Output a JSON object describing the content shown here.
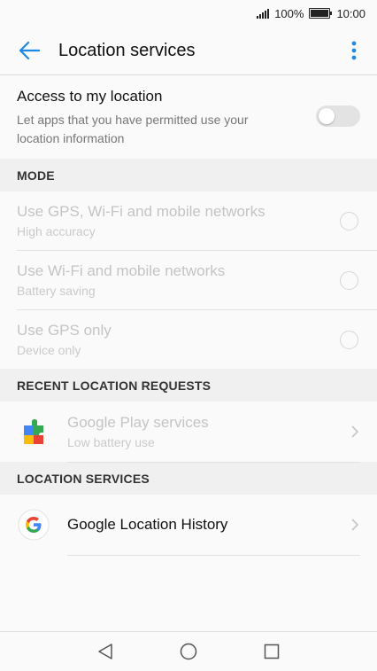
{
  "status_bar": {
    "battery_percent": "100%",
    "battery_level": 1.0,
    "time": "10:00"
  },
  "app_bar": {
    "title": "Location services",
    "back_icon": "arrow-left-icon",
    "more_icon": "more-vert-icon",
    "accent": "#1e88e5"
  },
  "access": {
    "title": "Access to my location",
    "description": "Let apps that you have permitted use your location information",
    "enabled": false
  },
  "mode": {
    "header": "MODE",
    "options": [
      {
        "title": "Use GPS, Wi-Fi and mobile networks",
        "subtitle": "High accuracy",
        "selected": false
      },
      {
        "title": "Use Wi-Fi and mobile networks",
        "subtitle": "Battery saving",
        "selected": false
      },
      {
        "title": "Use GPS only",
        "subtitle": "Device only",
        "selected": false
      }
    ]
  },
  "recent_requests": {
    "header": "RECENT LOCATION REQUESTS",
    "items": [
      {
        "title": "Google Play services",
        "subtitle": "Low battery use",
        "icon": "google-play-services-icon"
      }
    ]
  },
  "location_services": {
    "header": "LOCATION SERVICES",
    "items": [
      {
        "title": "Google Location History",
        "icon": "google-g-icon"
      }
    ]
  },
  "nav_bar": {
    "back_icon": "triangle-back-icon",
    "home_icon": "circle-home-icon",
    "recents_icon": "square-recents-icon"
  }
}
